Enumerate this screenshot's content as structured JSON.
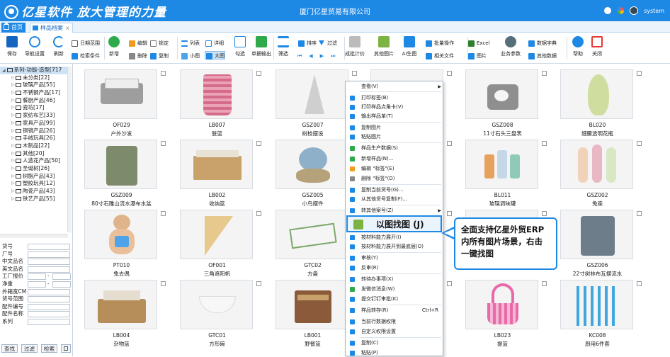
{
  "app": {
    "brand": "亿星软件  放大管理的力量",
    "company": "厦门亿星贸易有限公司",
    "user": "system"
  },
  "tabs": {
    "home": "首页",
    "active": "样品档案",
    "close": "x"
  },
  "toolbar": {
    "save": "保存",
    "nav_settings": "导航设置",
    "refresh": "刷新",
    "date_range": "日期范围",
    "search_cond": "检索条件",
    "add": "新增",
    "edit": "编辑",
    "lock": "锁定",
    "delete": "删除",
    "copy": "复制",
    "list": "列表",
    "detail": "详细",
    "small": "小图",
    "large": "大图",
    "check": "勾选",
    "export_sheet": "单据输出",
    "filter": "筛选",
    "sort": "排序",
    "filter2": "过滤",
    "cost_calc": "成批计价",
    "other_images": "其他图片",
    "ai_image": "AI生图",
    "batch_ops": "批量操作",
    "related_files": "相关文件",
    "excel": "Excel",
    "picture": "图片",
    "business_params": "业务参数",
    "data_dict": "数据字典",
    "other_data": "其他数据",
    "help": "帮助",
    "close": "关闭"
  },
  "tree": {
    "root": "系列-功能-造型[717",
    "items": [
      "未分类[22]",
      "玻璃产品[55]",
      "不锈钢产品[17]",
      "餐厨产品[46]",
      "瓷坊[17]",
      "家纺布艺[33]",
      "家具产品[99]",
      "铜镜产品[26]",
      "手绒玩具[26]",
      "木制品[22]",
      "其他[20]",
      "人造花产品[50]",
      "圣诞树[26]",
      "树脂产品[43]",
      "塑胶玩具[12]",
      "陶瓷产品[43]",
      "铁艺产品[55]"
    ]
  },
  "form": {
    "fields": [
      "货号",
      "厂号",
      "中文品名",
      "英文品名",
      "工厂报价",
      "净重",
      "外箱宽CM",
      "货号范围",
      "配件编号",
      "配件名称",
      "系列"
    ],
    "dash": "-",
    "buttons": [
      "查找",
      "过滤",
      "检索"
    ]
  },
  "products": [
    {
      "code": "OF029",
      "name": "户外沙发"
    },
    {
      "code": "LB007",
      "name": "脏篮"
    },
    {
      "code": "GSZ007",
      "name": "树枝摆设"
    },
    {
      "code": "",
      "name": ""
    },
    {
      "code": "GSZ008",
      "name": "11寸石头三盘表"
    },
    {
      "code": "BL020",
      "name": "细腰透明花瓶"
    },
    {
      "code": "GSZ009",
      "name": "80寸石雕山流水瀑布水盆"
    },
    {
      "code": "LB002",
      "name": "收纳篮"
    },
    {
      "code": "GSZ005",
      "name": "小鸟摆件"
    },
    {
      "code": "",
      "name": ""
    },
    {
      "code": "BL011",
      "name": "玻璃调味罐"
    },
    {
      "code": "GSZ002",
      "name": "兔座"
    },
    {
      "code": "PT010",
      "name": "兔去偶"
    },
    {
      "code": "OF001",
      "name": "三角遮阳帆"
    },
    {
      "code": "GTC02",
      "name": "方盘"
    },
    {
      "code": "",
      "name": ""
    },
    {
      "code": "",
      "name": ""
    },
    {
      "code": "GSZ006",
      "name": "22寸树林布瓦摆流水"
    },
    {
      "code": "LB004",
      "name": "杂物篮"
    },
    {
      "code": "GTC01",
      "name": "方形碗"
    },
    {
      "code": "LB001",
      "name": "野餐篮"
    },
    {
      "code": "",
      "name": ""
    },
    {
      "code": "LB023",
      "name": "提篮"
    },
    {
      "code": "KC008",
      "name": "厨用6件套"
    }
  ],
  "menu": {
    "items": [
      "查看(V)",
      "打印标签(B)",
      "打印样品点角卡(V)",
      "输出样品单(T)",
      "复制图片",
      "粘贴图片",
      "样品生产数据(S)",
      "新增样品(N)...",
      "编辑 \"标签\"(E)",
      "删除 \"标签\"(D)",
      "复制当前货号(G)...",
      "从其他货号复制(F)...",
      "转其他案号(Z)",
      "以图找图 (J)",
      "按材料能力展开(I)",
      "按材料能力展开到最底层(O)",
      "审核(Y)",
      "反审(R)",
      "转待办事项(X)",
      "发微信消息(W)",
      "提交钉钉审批(K)",
      "样品转存(R)",
      "当前行数据权限",
      "自定义权限设置",
      "复制(C)",
      "粘贴(P)"
    ],
    "shortcut": "Ctrl+R"
  },
  "callout": {
    "text": "全面支持亿星外贸ERP内所有图片场景，右击一键找图"
  },
  "colors": {
    "primary": "#1e88e5",
    "tree_selected": "#cfe3f7"
  }
}
